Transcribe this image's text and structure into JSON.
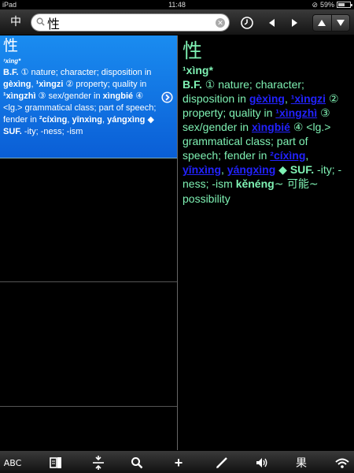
{
  "status": {
    "device": "iPad",
    "time": "11:48",
    "battery": "59%",
    "battery_fraction": 0.59
  },
  "toolbar": {
    "mode_label": "中",
    "search_value": "性",
    "clock_icon": "clock-icon",
    "back_icon": "triangle-left-icon",
    "forward_icon": "triangle-right-icon",
    "up_icon": "triangle-up-icon",
    "down_icon": "triangle-down-icon"
  },
  "list": {
    "selected": {
      "headword": "性",
      "pinyin": "¹xìng*",
      "def_parts": [
        "B.F.",
        " ① nature; character; disposition in ",
        "gèxìng",
        ", ",
        "¹xìngzi",
        " ② property; quality in ",
        "¹xìngzhì",
        " ③ sex/gender in ",
        "xìngbié",
        " ④ <lg.> grammatical class; part of speech; fender in ",
        "²cíxìng",
        ", ",
        "yīnxìng",
        ", ",
        "yángxìng",
        " ◆ ",
        "SUF.",
        " -ity; -ness; -ism"
      ]
    }
  },
  "detail": {
    "headword": "性",
    "pinyin": "¹xìng*",
    "bf": "B.F.",
    "t1": " ① nature; character; disposition in ",
    "l1": "gèxìng",
    "t2": ", ",
    "l2": "¹xìngzi",
    "t3": " ② property; quality in ",
    "l3": "¹xìngzhì",
    "t4": " ③ sex/gender in ",
    "l4": "xìngbié",
    "t5": " ④ <lg.> grammatical class; part of speech; fender in ",
    "l5": "²cíxìng",
    "t6": ", ",
    "l6": "yīnxìng",
    "t7": ", ",
    "l7": "yángxìng",
    "t8": " ◆ ",
    "suf": "SUF.",
    "t9": " -ity; -ness; -ism ",
    "ex_py": "kěnéng",
    "ex_hz": "~ 可能~",
    "ex_en": " possibility"
  },
  "bottombar": {
    "abc": "ABC",
    "flashcard": "flashcard-icon",
    "split": "split-arrows-icon",
    "search": "search-icon",
    "add": "+",
    "pen": "pen-icon",
    "audio": "speaker-icon",
    "radical": "果",
    "wifi": "wifi-icon"
  }
}
